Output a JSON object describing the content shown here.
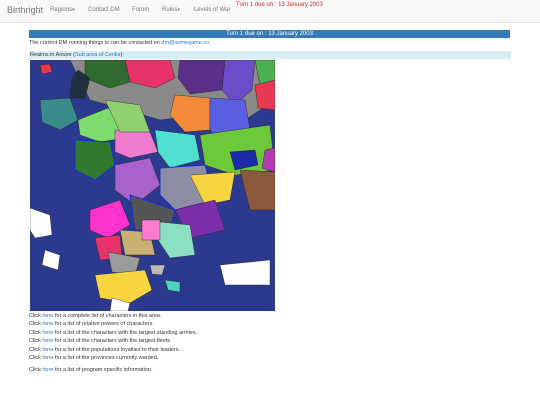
{
  "navbar": {
    "brand": "Birthright",
    "items": [
      {
        "label": "Regions",
        "has_caret": true
      },
      {
        "label": "Contact DM",
        "has_caret": false
      },
      {
        "label": "Forum",
        "has_caret": false
      },
      {
        "label": "Rules",
        "has_caret": true
      },
      {
        "label": "Levels of War",
        "has_caret": false
      }
    ],
    "turn_notice": "Turn 1 due on : 13 January 2003"
  },
  "turn_bar": "Turn 1 due on : 13 January 2003",
  "contact": {
    "prefix": "The current DM running things is can be contacted on ",
    "email": "dm@somegame.co"
  },
  "realms": {
    "prefix": "Realms in Anuire (",
    "link": "Sub area of Cerilia",
    "suffix": "):"
  },
  "map": {
    "sea_color": "#2b3a8f",
    "border_color": "#1a2fd6"
  },
  "links": [
    {
      "pre": "Click ",
      "link": "here",
      "post": " for a complete list of characters in this area."
    },
    {
      "pre": "Click ",
      "link": "here",
      "post": " for a list of relative powers of characters."
    },
    {
      "pre": "Click ",
      "link": "here",
      "post": " for a list of the characters with the largest standing armies."
    },
    {
      "pre": "Click ",
      "link": "here",
      "post": " for a list of the characters with the largest fleets."
    },
    {
      "pre": "Click ",
      "link": "here",
      "post": " for a list of the populations loyalties to their leaders."
    },
    {
      "pre": "Click ",
      "link": "here",
      "post": " for a list of the provinces currently warded."
    }
  ],
  "program_link": {
    "pre": "Click ",
    "link": "here",
    "post": " for a list of program specific information."
  }
}
